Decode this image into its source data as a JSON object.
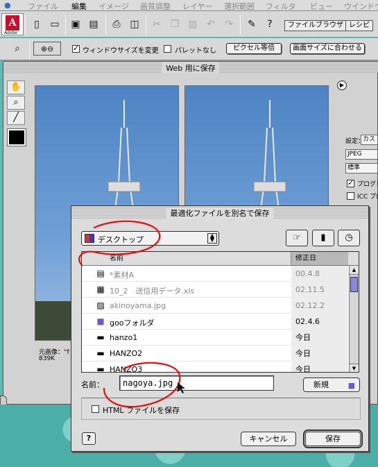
{
  "menubar": {
    "items": [
      "ファイル",
      "編集",
      "イメージ",
      "画質調整",
      "レイヤー",
      "選択範囲",
      "フィルタ",
      "ビュー",
      "ウインドウ"
    ],
    "active_index": 1
  },
  "toolbar": {
    "logo_text": "Adobe",
    "tabs": [
      "ファイルブラウザ",
      "レシピ"
    ]
  },
  "options_bar": {
    "fit_window_label": "ウィンドウサイズを変更",
    "fit_window_checked": true,
    "ignore_palettes_label": "パレットなし",
    "ignore_palettes_checked": false,
    "actual_pixels_button": "ピクセル等倍",
    "fit_screen_button": "画面サイズに合わせる",
    "zoom_icons": [
      "zoom-icon",
      "zoom-in-out-icon"
    ]
  },
  "web_save_window": {
    "title": "Web 用に保存",
    "original_info_line1": "元画像：“f",
    "original_info_line2": "839K",
    "right_panel": {
      "settings_label": "設定：",
      "settings_value": "カス",
      "format": "JPEG",
      "quality": "標準",
      "progressive_label": "プログレ",
      "progressive_checked": true,
      "icc_label": "ICC プロ",
      "icc_checked": false
    }
  },
  "save_dialog": {
    "title": "最適化ファイルを別名で保存",
    "location": "デスクトップ",
    "columns": {
      "name": "名前",
      "date": "修正日"
    },
    "files": [
      {
        "name": "*素材A",
        "date": "00.4.8",
        "icon": "document-icon",
        "dim": true
      },
      {
        "name": "10_2　送信用データ.xls",
        "date": "02.11.5",
        "icon": "spreadsheet-icon",
        "dim": true
      },
      {
        "name": "akinoyama.jpg",
        "date": "02.12.2",
        "icon": "image-file-icon",
        "dim": true
      },
      {
        "name": "gooフォルダ",
        "date": "02.4.6",
        "icon": "folder-icon",
        "dim": false
      },
      {
        "name": "hanzo1",
        "date": "今日",
        "icon": "disk-icon",
        "dim": false
      },
      {
        "name": "HANZO2",
        "date": "今日",
        "icon": "disk-icon",
        "dim": false
      },
      {
        "name": "HANZO3",
        "date": "今日",
        "icon": "disk-icon",
        "dim": false
      }
    ],
    "name_label": "名前：",
    "name_value": "nagoya.jpg",
    "new_button": "新規",
    "save_html_label": "HTML ファイルを保存",
    "save_html_checked": false,
    "help_label": "?",
    "cancel_button": "キャンセル",
    "save_button": "保存"
  },
  "colors": {
    "desktop": "#5fb8b2",
    "annotation": "#e01010"
  }
}
